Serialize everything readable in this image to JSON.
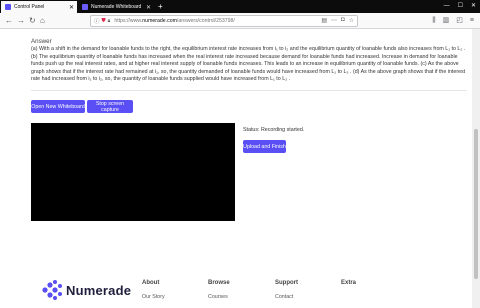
{
  "browser": {
    "tabs": [
      {
        "label": "Control Panel",
        "active": true
      },
      {
        "label": "Numerade Whiteboard",
        "active": false
      }
    ],
    "url_prefix": "https://www.",
    "url_host": "numerade.com",
    "url_path": "/answers/control/253798/"
  },
  "answer": {
    "heading": "Answer",
    "body": "(a) With a shift in the demand for loanable funds to the right, the equilibrium interest rate increases from i₁ to i₂ and the equilibrium quantity of loanable funds also increases from L₁ to L₂ . (b) The equilibrium quantity of loanable funds has increased when the real interest rate increased because demand for loanable funds had increased. Increase in demand for loanable funds push up the real interest rates, and at higher real interest supply of loanable funds increases. This leads to an increase in equilibrium quantity of loanable funds. (c) As the above graph shows that if the interest rate had remained at i₁, so, the quantity demanded of loanable funds would have increased from L₁ to L₃ . (d) As the above graph shows that if the interest rate had increased from i₁ to i₂, so, the quantity of loanable funds supplied would have increased from L₁ to L₂ ."
  },
  "controls": {
    "open_whiteboard": "Open New Whiteboard",
    "stop_capture": "Stop screen capture",
    "status": "Status: Recording started.",
    "upload_finish": "Upload and Finish"
  },
  "footer": {
    "logo_text": "Numerade",
    "columns": [
      {
        "title": "About",
        "link": "Our Story"
      },
      {
        "title": "Browse",
        "link": "Courses"
      },
      {
        "title": "Support",
        "link": "Contact"
      },
      {
        "title": "Extra",
        "link": ""
      }
    ]
  },
  "colors": {
    "accent": "#5a4ff4",
    "recording_area": "#000000"
  }
}
